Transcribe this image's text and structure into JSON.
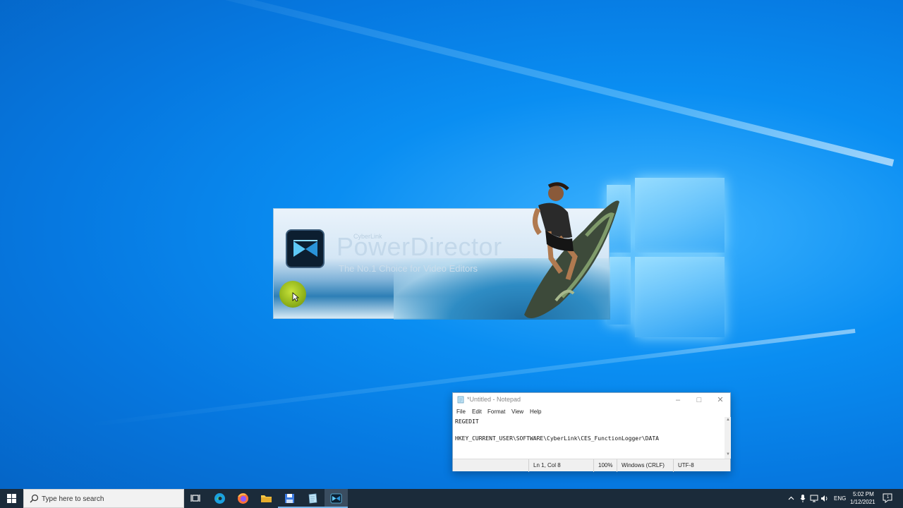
{
  "splash": {
    "brand_small": "CyberLink",
    "title": "PowerDirector",
    "tagline": "The No.1 Choice for Video Editors"
  },
  "notepad": {
    "title": "*Untitled - Notepad",
    "menu": [
      "File",
      "Edit",
      "Format",
      "View",
      "Help"
    ],
    "lines": [
      "REGEDIT",
      "",
      "HKEY_CURRENT_USER\\SOFTWARE\\CyberLink\\CES_FunctionLogger\\DATA"
    ],
    "status": {
      "position": "Ln 1, Col 8",
      "zoom": "100%",
      "line_ending": "Windows (CRLF)",
      "encoding": "UTF-8"
    }
  },
  "taskbar": {
    "search_placeholder": "Type here to search",
    "apps": [
      "task-view",
      "edge",
      "firefox",
      "file-explorer",
      "save-disk",
      "notepad",
      "powerdirector"
    ],
    "tray": {
      "language": "ENG",
      "time": "5:02 PM",
      "date": "1/12/2021",
      "notification_count": "1"
    }
  }
}
